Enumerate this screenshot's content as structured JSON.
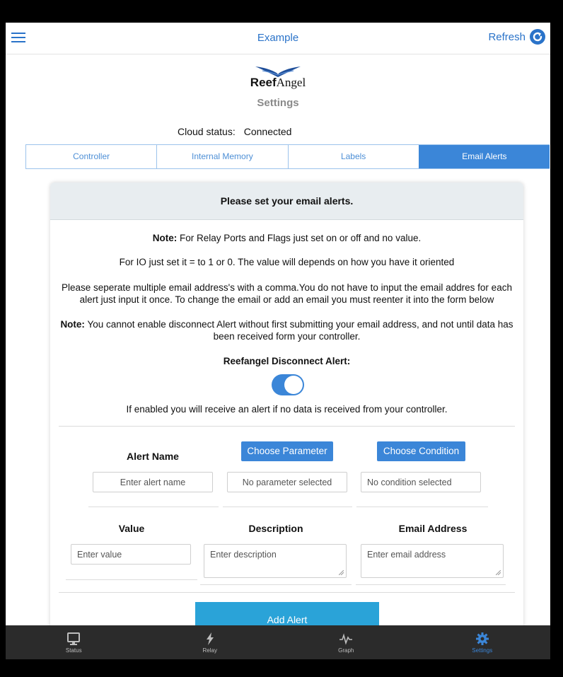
{
  "header": {
    "title": "Example",
    "refresh_label": "Refresh"
  },
  "logo": {
    "bold": "Reef",
    "rest": "Angel"
  },
  "page_title": "Settings",
  "cloud": {
    "label": "Cloud status:",
    "value": "Connected"
  },
  "tabs": [
    {
      "label": "Controller"
    },
    {
      "label": "Internal Memory"
    },
    {
      "label": "Labels"
    },
    {
      "label": "Email Alerts"
    }
  ],
  "card": {
    "heading": "Please set your email alerts.",
    "note1_bold": "Note:",
    "note1": " For Relay Ports and Flags just set on or off and no value.",
    "note2": "For IO just set it = to 1 or 0. The value will depends on how you have it oriented",
    "note3": "Please seperate multiple email address's with a comma.You do not have to input the email addres for each alert just input it once. To change the email or add an email you must reenter it into the form below",
    "note4_bold": "Note:",
    "note4": " You cannot enable disconnect Alert without first submitting your email address, and not until data has been received form your controller.",
    "disconnect_label": "Reefangel Disconnect Alert:",
    "disconnect_desc": "If enabled you will receive an alert if no data is received from your controller."
  },
  "form": {
    "alert_name_label": "Alert Name",
    "choose_parameter": "Choose Parameter",
    "choose_condition": "Choose Condition",
    "alert_name_placeholder": "Enter alert name",
    "parameter_placeholder": "No parameter selected",
    "condition_placeholder": "No condition selected",
    "value_label": "Value",
    "description_label": "Description",
    "email_label": "Email Address",
    "value_placeholder": "Enter value",
    "description_placeholder": "Enter description",
    "email_placeholder": "Enter email address",
    "add_alert": "Add Alert"
  },
  "nav": [
    {
      "label": "Status",
      "icon": "monitor-icon"
    },
    {
      "label": "Relay",
      "icon": "lightning-icon"
    },
    {
      "label": "Graph",
      "icon": "pulse-icon"
    },
    {
      "label": "Settings",
      "icon": "gear-icon"
    }
  ],
  "colors": {
    "accent": "#3b86d8",
    "add_button": "#2aa3d8",
    "nav_bg": "#2b2b2b"
  }
}
